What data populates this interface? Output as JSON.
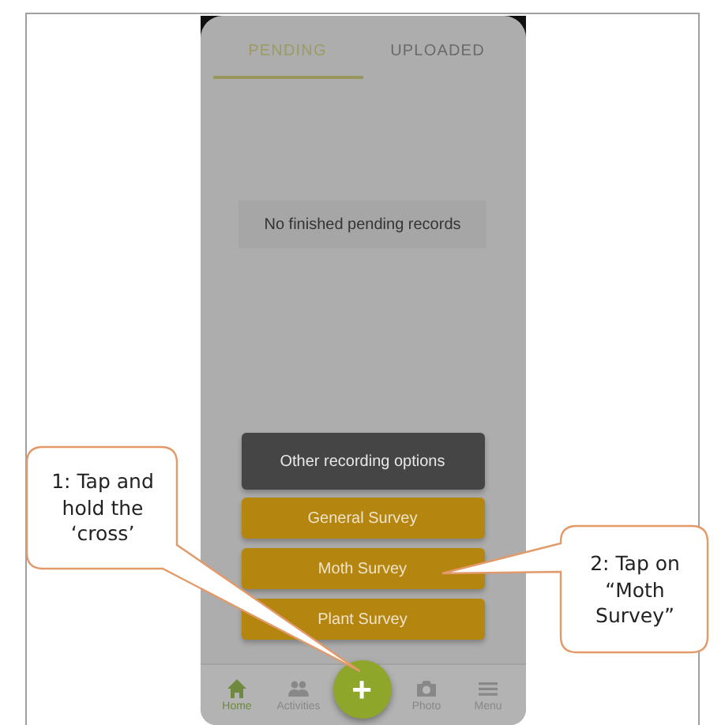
{
  "tabs": [
    {
      "label": "PENDING",
      "selected": true
    },
    {
      "label": "UPLOADED",
      "selected": false
    }
  ],
  "empty_message": "No finished pending records",
  "options": [
    {
      "label": "Other recording options",
      "kind": "secondary"
    },
    {
      "label": "General Survey",
      "kind": "primary"
    },
    {
      "label": "Moth Survey",
      "kind": "primary"
    },
    {
      "label": "Plant Survey",
      "kind": "primary"
    }
  ],
  "nav": [
    {
      "label": "Home",
      "kind": "home",
      "selected": true
    },
    {
      "label": "Activities",
      "kind": "people",
      "selected": false
    },
    {
      "label": "Photo",
      "kind": "camera",
      "selected": false
    },
    {
      "label": "Menu",
      "kind": "menu",
      "selected": false
    }
  ],
  "fab": {
    "label": "+"
  },
  "callouts": [
    {
      "text": "1: Tap and hold the ‘cross’",
      "kind": "left"
    },
    {
      "text": "2: Tap on “Moth Survey”",
      "kind": "right"
    }
  ]
}
